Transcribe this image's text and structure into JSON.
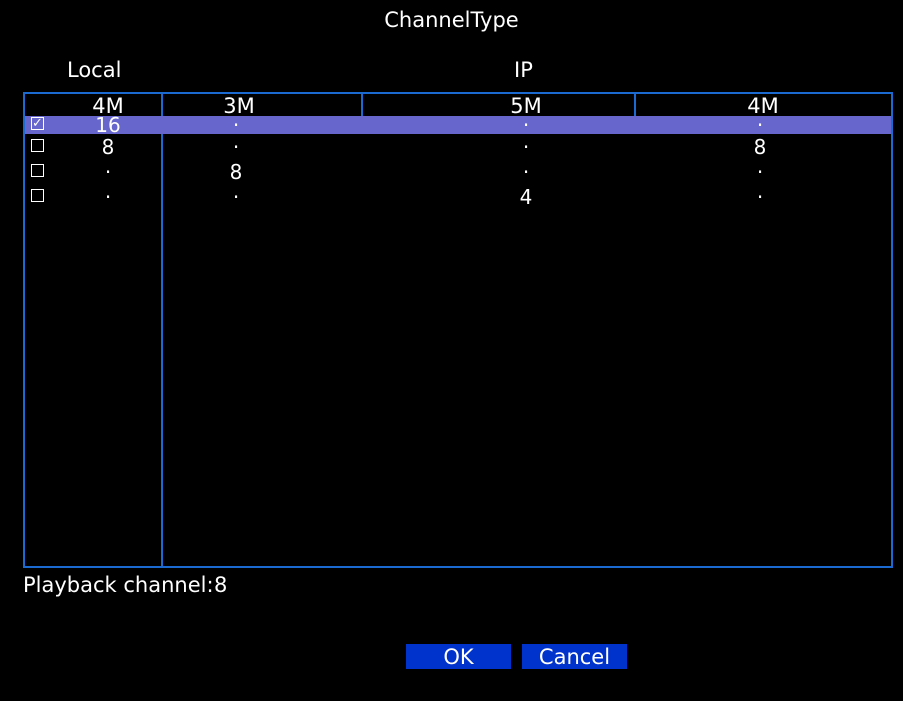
{
  "dialog": {
    "title": "ChannelType"
  },
  "sections": {
    "local": "Local",
    "ip": "IP"
  },
  "columns": [
    "4M",
    "3M",
    "5M",
    "4M"
  ],
  "rows": [
    {
      "checked": true,
      "cells": [
        "16",
        "·",
        "·",
        "·"
      ]
    },
    {
      "checked": false,
      "cells": [
        "8",
        "·",
        "·",
        "8"
      ]
    },
    {
      "checked": false,
      "cells": [
        "·",
        "8",
        "·",
        "·"
      ]
    },
    {
      "checked": false,
      "cells": [
        "·",
        "·",
        "4",
        "·"
      ]
    }
  ],
  "playback": {
    "label": "Playback channel:",
    "value": "8"
  },
  "buttons": {
    "ok": "OK",
    "cancel": "Cancel"
  },
  "colors": {
    "border": "#1a6ad2",
    "selected": "#6666cc",
    "button": "#0033cc"
  }
}
